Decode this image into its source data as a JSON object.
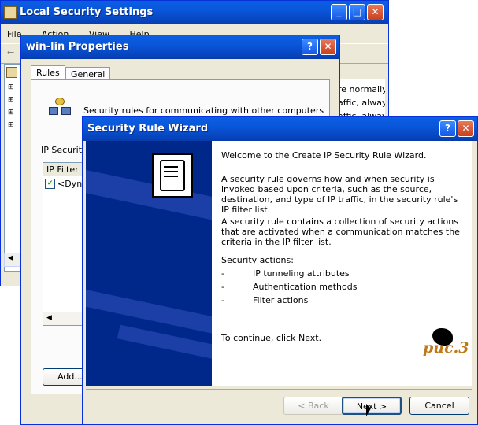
{
  "main_window": {
    "title": "Local Security Settings",
    "menu": [
      "File",
      "Action",
      "View",
      "Help"
    ],
    "right_text": [
      "re normally c",
      "affic, always",
      "affic, always"
    ]
  },
  "properties": {
    "title": "win-lin Properties",
    "tabs": [
      "Rules",
      "General"
    ],
    "description": "Security rules for communicating with other computers",
    "ip_security_label": "IP Security",
    "filter_header": "IP Filter L",
    "filter_item": "<Dyna",
    "add_button": "Add..."
  },
  "wizard": {
    "title": "Security Rule Wizard",
    "welcome": "Welcome to the Create IP Security Rule Wizard.",
    "para1": "A security rule governs how and when security is invoked based upon criteria, such as the source, destination, and type of IP traffic, in the security rule's IP filter list.",
    "para2": "A security rule contains a collection of security actions that are activated when a communication matches the criteria in the IP filter list.",
    "actions_label": "Security actions:",
    "actions": [
      "IP tunneling attributes",
      "Authentication methods",
      "Filter actions"
    ],
    "continue": "To continue, click Next.",
    "watermark": "puc.3",
    "back_button": "< Back",
    "next_button": "Next >",
    "cancel_button": "Cancel"
  }
}
